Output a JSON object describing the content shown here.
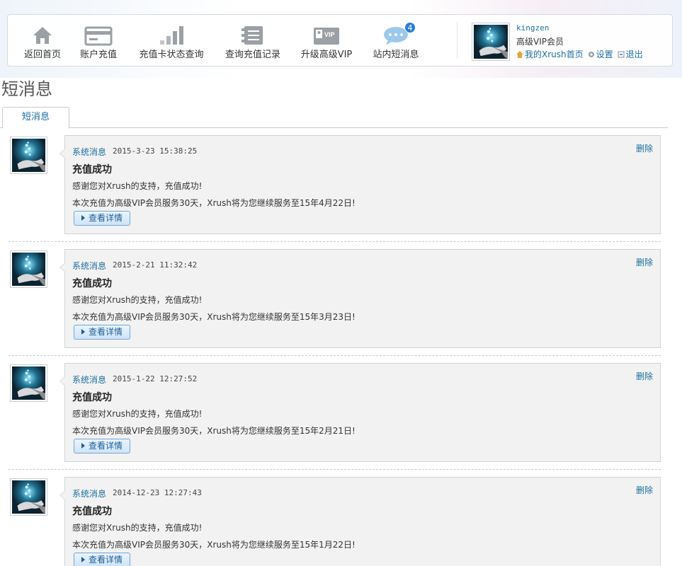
{
  "nav": {
    "items": [
      {
        "label": "返回首页",
        "icon": "home-icon"
      },
      {
        "label": "账户充值",
        "icon": "card-icon"
      },
      {
        "label": "充值卡状态查询",
        "icon": "signal-bars-icon"
      },
      {
        "label": "查询充值记录",
        "icon": "records-icon"
      },
      {
        "label": "升级高级VIP",
        "icon": "vip-icon"
      },
      {
        "label": "站内短消息",
        "icon": "chat-bubble-icon",
        "badge": "4"
      }
    ]
  },
  "user": {
    "name": "kingzen",
    "level": "高级VIP会员",
    "home_link": "我的Xrush首页",
    "settings_link": "设置",
    "logout_link": "退出"
  },
  "page": {
    "title": "短消息",
    "tab": "短消息"
  },
  "messages": [
    {
      "sender": "系统消息",
      "time": "2015-3-23 15:38:25",
      "delete": "删除",
      "subject": "充值成功",
      "line1": "感谢您对Xrush的支持，充值成功!",
      "line2": "本次充值为高级VIP会员服务30天，Xrush将为您继续服务至15年4月22日!",
      "detail": "查看详情"
    },
    {
      "sender": "系统消息",
      "time": "2015-2-21 11:32:42",
      "delete": "删除",
      "subject": "充值成功",
      "line1": "感谢您对Xrush的支持，充值成功!",
      "line2": "本次充值为高级VIP会员服务30天，Xrush将为您继续服务至15年3月23日!",
      "detail": "查看详情"
    },
    {
      "sender": "系统消息",
      "time": "2015-1-22 12:27:52",
      "delete": "删除",
      "subject": "充值成功",
      "line1": "感谢您对Xrush的支持，充值成功!",
      "line2": "本次充值为高级VIP会员服务30天，Xrush将为您继续服务至15年2月21日!",
      "detail": "查看详情"
    },
    {
      "sender": "系统消息",
      "time": "2014-12-23 12:27:43",
      "delete": "删除",
      "subject": "充值成功",
      "line1": "感谢您对Xrush的支持，充值成功!",
      "line2": "本次充值为高级VIP会员服务30天，Xrush将为您继续服务至15年1月22日!",
      "detail": "查看详情"
    }
  ],
  "colors": {
    "link": "#1a6e9e",
    "badge": "#2a7ed1",
    "bubble_bg": "#f2f2f2"
  }
}
